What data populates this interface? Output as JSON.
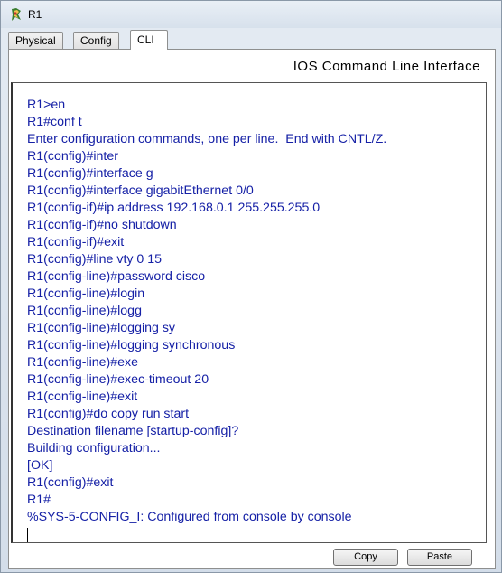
{
  "window": {
    "title": "R1"
  },
  "tabs": [
    {
      "label": "Physical",
      "active": false
    },
    {
      "label": "Config",
      "active": false
    },
    {
      "label": "CLI",
      "active": true
    }
  ],
  "panel": {
    "heading": "IOS Command Line Interface"
  },
  "terminal": {
    "text_color": "#1520a6",
    "lines": [
      "R1>en",
      "R1#conf t",
      "Enter configuration commands, one per line.  End with CNTL/Z.",
      "R1(config)#inter",
      "R1(config)#interface g",
      "R1(config)#interface gigabitEthernet 0/0",
      "R1(config-if)#ip address 192.168.0.1 255.255.255.0",
      "R1(config-if)#no shutdown",
      "R1(config-if)#exit",
      "R1(config)#line vty 0 15",
      "R1(config-line)#password cisco",
      "R1(config-line)#login",
      "R1(config-line)#logg",
      "R1(config-line)#logging sy",
      "R1(config-line)#logging synchronous",
      "R1(config-line)#exe",
      "R1(config-line)#exec-timeout 20",
      "R1(config-line)#exit",
      "R1(config)#do copy run start",
      "Destination filename [startup-config]?",
      "Building configuration...",
      "[OK]",
      "R1(config)#exit",
      "R1#",
      "%SYS-5-CONFIG_I: Configured from console by console"
    ]
  },
  "buttons": {
    "copy_label": "Copy",
    "paste_label": "Paste"
  }
}
